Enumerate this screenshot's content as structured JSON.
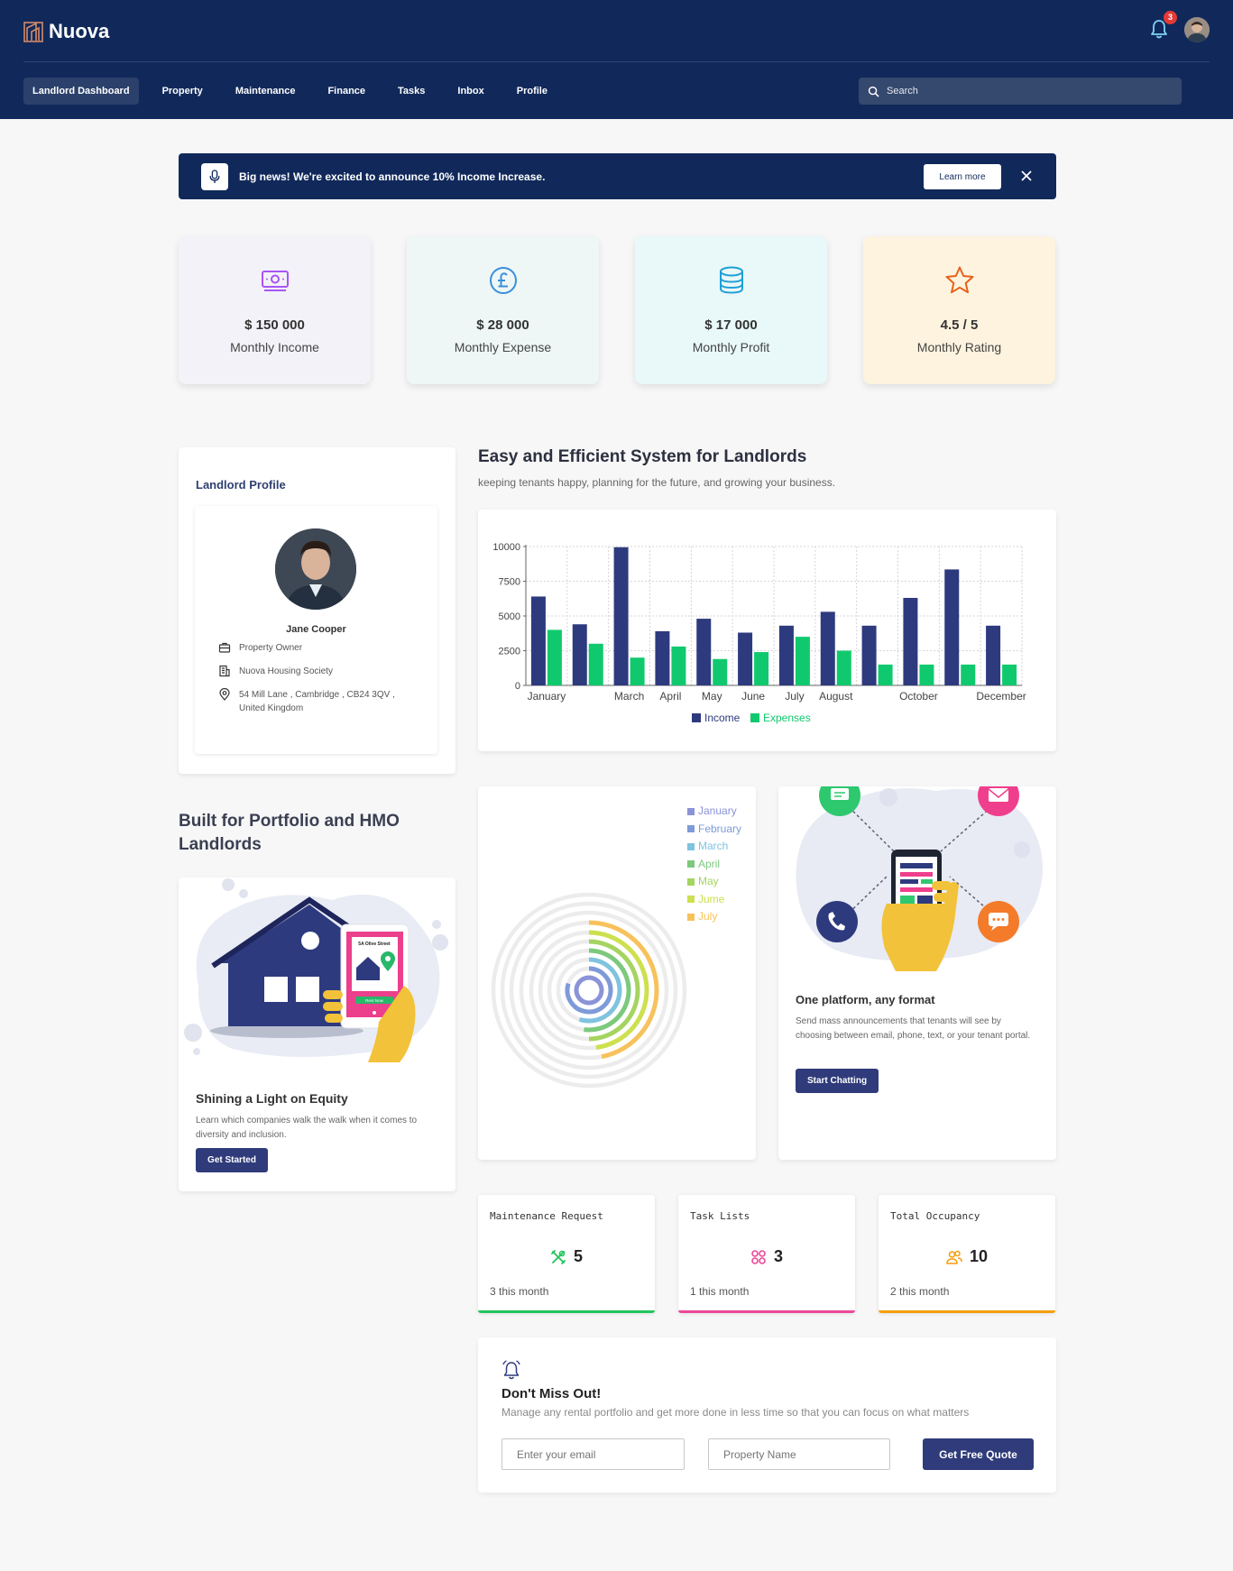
{
  "app": {
    "name": "Nuova",
    "notification_count": "3"
  },
  "nav": {
    "items": [
      {
        "label": "Landlord Dashboard",
        "active": true
      },
      {
        "label": "Property"
      },
      {
        "label": "Maintenance"
      },
      {
        "label": "Finance"
      },
      {
        "label": "Tasks"
      },
      {
        "label": "Inbox"
      },
      {
        "label": "Profile"
      }
    ],
    "search_placeholder": "Search"
  },
  "announcement": {
    "text": "Big news! We're excited to announce 10% Income Increase.",
    "button": "Learn more"
  },
  "stats": [
    {
      "value": "$ 150 000",
      "label": "Monthly Income",
      "icon": "money-icon",
      "bg": "#f3f2f8",
      "color": "#a855f7"
    },
    {
      "value": "$ 28 000",
      "label": "Monthly Expense",
      "icon": "pound-icon",
      "bg": "#eef6f6",
      "color": "#3b8fd9"
    },
    {
      "value": "$ 17 000",
      "label": "Monthly Profit",
      "icon": "coins-icon",
      "bg": "#e9f8f9",
      "color": "#1f9fd8"
    },
    {
      "value": "4.5 / 5",
      "label": "Monthly Rating",
      "icon": "star-icon",
      "bg": "#fdf3df",
      "color": "#e8611a"
    }
  ],
  "profile": {
    "title": "Landlord Profile",
    "name": "Jane Cooper",
    "role": "Property Owner",
    "company": "Nuova Housing Society",
    "address": "54 Mill Lane , Cambridge , CB24 3QV , United Kingdom"
  },
  "hero": {
    "title": "Easy and Efficient System for Landlords",
    "subtitle": "keeping tenants happy, planning for the future, and growing your business."
  },
  "chart_data": {
    "type": "bar",
    "categories": [
      "January",
      "February",
      "March",
      "April",
      "May",
      "June",
      "July",
      "August",
      "September",
      "October",
      "November",
      "December"
    ],
    "tick_labels_shown": [
      "January",
      "",
      "March",
      "April",
      "May",
      "June",
      "July",
      "August",
      "",
      "October",
      "",
      "December"
    ],
    "series": [
      {
        "name": "Income",
        "color": "#2e3a7e",
        "values": [
          6400,
          4400,
          9950,
          3900,
          4800,
          3800,
          4300,
          5300,
          4300,
          6300,
          8350,
          4300
        ]
      },
      {
        "name": "Expenses",
        "color": "#10c96e",
        "values": [
          4000,
          3000,
          2000,
          2800,
          1900,
          2400,
          3500,
          2500,
          1500,
          1500,
          1500,
          1500
        ]
      }
    ],
    "y_ticks": [
      "0",
      "2500",
      "5000",
      "7500",
      "10000"
    ],
    "ylim": [
      0,
      10000
    ],
    "grid": true,
    "legend": "bottom"
  },
  "radial": {
    "legend": [
      {
        "label": "January",
        "color": "#8b93d8"
      },
      {
        "label": "February",
        "color": "#7f9ad8"
      },
      {
        "label": "March",
        "color": "#7fc3df"
      },
      {
        "label": "April",
        "color": "#7cc97e"
      },
      {
        "label": "May",
        "color": "#a5d460"
      },
      {
        "label": "Jume",
        "color": "#cde04e"
      },
      {
        "label": "July",
        "color": "#f7c25c"
      }
    ]
  },
  "portfolio": {
    "title": "Built for Portfolio and HMO Landlords",
    "card_title": "Shining a Light on Equity",
    "card_text": "Learn which companies walk the walk when it comes to diversity and inclusion.",
    "button": "Get Started",
    "phone_sign": "5A Olive Street",
    "phone_button": "Rent Now"
  },
  "platform": {
    "title": "One platform, any format",
    "text": "Send mass announcements that tenants will see by choosing between email, phone, text, or your tenant portal.",
    "button": "Start Chatting"
  },
  "mini_stats": [
    {
      "title": "Maintenance Request",
      "value": "5",
      "sub": "3 this month",
      "color": "#22c55e",
      "icon": "tools-icon"
    },
    {
      "title": "Task Lists",
      "value": "3",
      "sub": "1 this month",
      "color": "#ec4899",
      "icon": "grid-icon"
    },
    {
      "title": "Total Occupancy",
      "value": "10",
      "sub": "2 this month",
      "color": "#f59e0b",
      "icon": "people-icon"
    }
  ],
  "newsletter": {
    "title": "Don't Miss Out!",
    "subtitle": "Manage any rental portfolio and get more done in less time so that you can focus on what matters",
    "email_placeholder": "Enter your email",
    "property_placeholder": "Property Name",
    "button": "Get Free Quote"
  }
}
